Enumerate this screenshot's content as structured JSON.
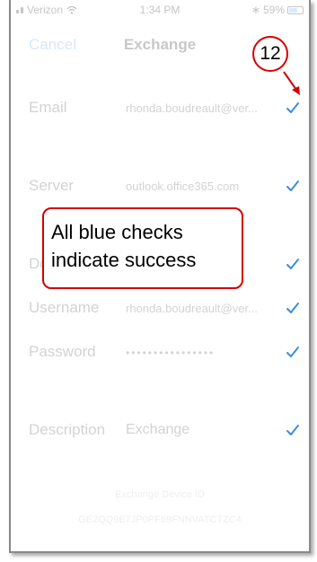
{
  "status": {
    "carrier": "Verizon",
    "time": "1:34 PM",
    "battery": "59%",
    "battery_level": 0.59
  },
  "nav": {
    "cancel_label": "Cancel",
    "title": "Exchange"
  },
  "rows": [
    {
      "label": "Email",
      "value": "rhonda.boudreault@ver...",
      "checked": true
    },
    {
      "label": "Server",
      "value": "outlook.office365.com",
      "checked": true
    },
    {
      "label": "Do",
      "value": "",
      "checked": true
    },
    {
      "label": "Username",
      "value": "rhonda.boudreault@ver...",
      "checked": true
    },
    {
      "label": "Password",
      "value": "••••••••••••••••",
      "checked": true
    },
    {
      "label": "Description",
      "value": "Exchange",
      "checked": true
    }
  ],
  "footer": {
    "device_id_label": "Exchange Device ID",
    "device_id": "GE2QQ9E7JP0PF69FNNVATCTZC4"
  },
  "annotation": {
    "callout_line1": "All blue checks",
    "callout_line2": "indicate success",
    "step_number": "12"
  },
  "colors": {
    "check": "#3b8de0",
    "annotation": "#d40000",
    "dimmed_text": "#d3d3d3"
  }
}
